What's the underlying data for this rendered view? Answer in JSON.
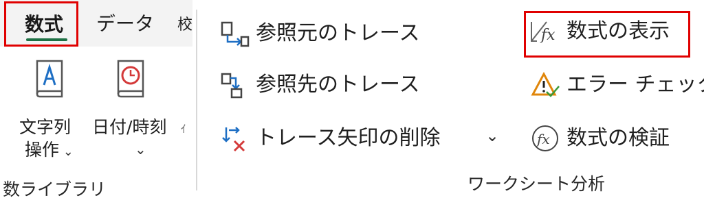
{
  "tabs": {
    "formulas": "数式",
    "data": "データ",
    "review_partial": "校"
  },
  "library": {
    "text_label_line1": "文字列",
    "text_label_line2": "操作",
    "datetime_label_line1": "日付/時刻",
    "partial": "ｨ",
    "group_label": "数ライブラリ"
  },
  "audit": {
    "trace_precedents": "参照元のトレース",
    "trace_dependents": "参照先のトレース",
    "remove_arrows": "トレース矢印の削除",
    "show_formulas": "数式の表示",
    "error_checking": "エラー チェック",
    "evaluate_formula": "数式の検証",
    "group_label": "ワークシート分析"
  },
  "icons": {
    "expand": "chevron-down-icon"
  },
  "colors": {
    "accent_green": "#1e7145",
    "highlight_red": "#e00000",
    "icon_blue": "#1e6fc4",
    "icon_red": "#d43a3a",
    "icon_orange": "#e0860a"
  }
}
